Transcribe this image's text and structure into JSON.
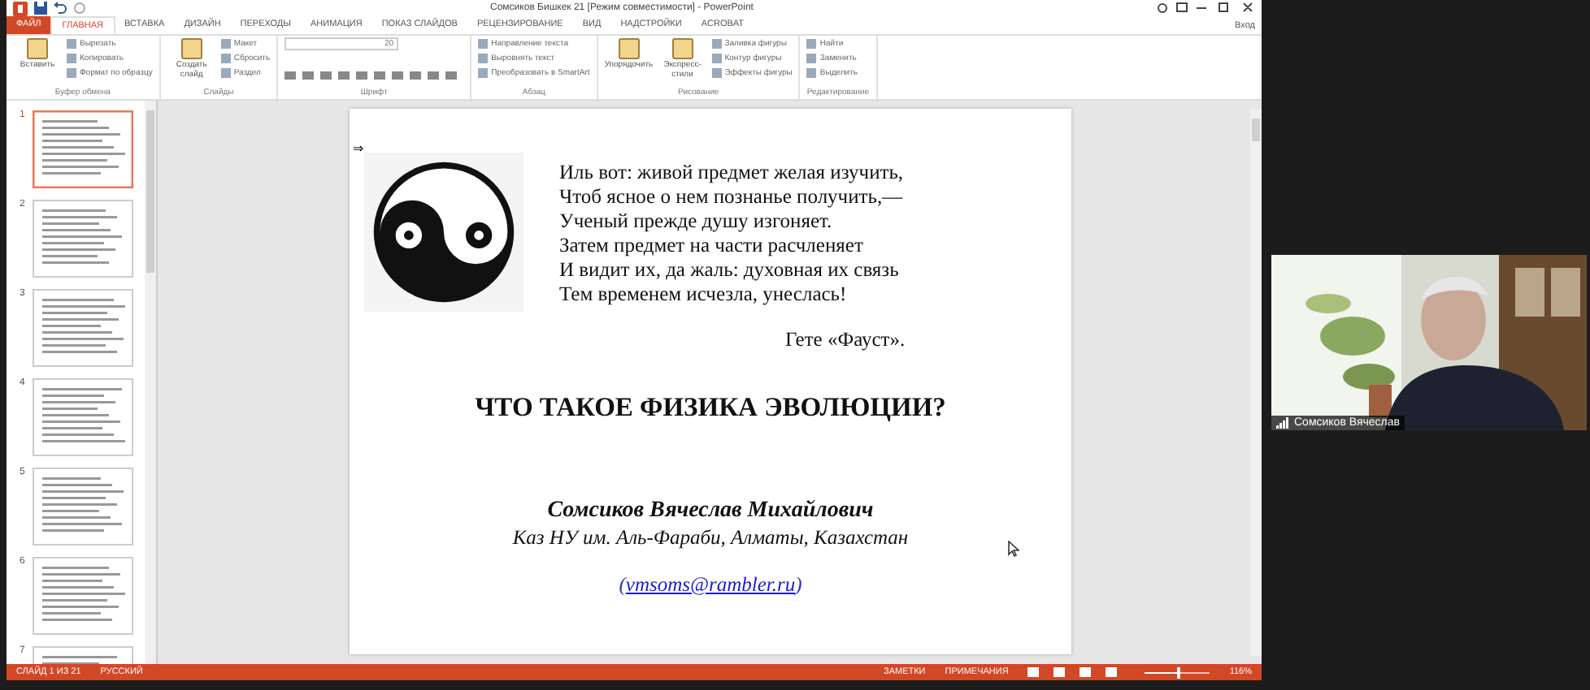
{
  "window": {
    "title": "Сомсиков Бишкек 21 [Режим совместимости] - PowerPoint",
    "sign_in": "Вход"
  },
  "ribbon_tabs": [
    {
      "label": "ФАЙЛ",
      "kind": "file",
      "selected": false
    },
    {
      "label": "ГЛАВНАЯ",
      "kind": "tab",
      "selected": true
    },
    {
      "label": "ВСТАВКА",
      "kind": "tab",
      "selected": false
    },
    {
      "label": "ДИЗАЙН",
      "kind": "tab",
      "selected": false
    },
    {
      "label": "ПЕРЕХОДЫ",
      "kind": "tab",
      "selected": false
    },
    {
      "label": "АНИМАЦИЯ",
      "kind": "tab",
      "selected": false
    },
    {
      "label": "ПОКАЗ СЛАЙДОВ",
      "kind": "tab",
      "selected": false
    },
    {
      "label": "РЕЦЕНЗИРОВАНИЕ",
      "kind": "tab",
      "selected": false
    },
    {
      "label": "ВИД",
      "kind": "tab",
      "selected": false
    },
    {
      "label": "НАДСТРОЙКИ",
      "kind": "tab",
      "selected": false
    },
    {
      "label": "ACROBAT",
      "kind": "tab",
      "selected": false
    }
  ],
  "ribbon_groups": [
    {
      "label": "Буфер обмена",
      "large": [
        "Вставить"
      ],
      "small": [
        "Вырезать",
        "Копировать",
        "Формат по образцу"
      ]
    },
    {
      "label": "Слайды",
      "large": [
        "Создать слайд"
      ],
      "small": [
        "Макет",
        "Сбросить",
        "Раздел"
      ]
    },
    {
      "label": "Шрифт",
      "font_size": "20"
    },
    {
      "label": "Абзац",
      "small": [
        "Направление текста",
        "Выровнять текст",
        "Преобразовать в SmartArt"
      ]
    },
    {
      "label": "Рисование",
      "large": [
        "Упорядочить",
        "Экспресс-стили"
      ],
      "small": [
        "Заливка фигуры",
        "Контур фигуры",
        "Эффекты фигуры"
      ]
    },
    {
      "label": "Редактирование",
      "small": [
        "Найти",
        "Заменить",
        "Выделить"
      ]
    }
  ],
  "thumbnails": [
    {
      "number": "1",
      "selected": true
    },
    {
      "number": "2",
      "selected": false
    },
    {
      "number": "3",
      "selected": false
    },
    {
      "number": "4",
      "selected": false
    },
    {
      "number": "5",
      "selected": false
    },
    {
      "number": "6",
      "selected": false
    },
    {
      "number": "7",
      "selected": false
    }
  ],
  "slide": {
    "marker": "⇒",
    "poem": [
      "Иль вот: живой предмет желая изучить,",
      "Чтоб ясное о нем познанье получить,—",
      "Ученый прежде душу изгоняет.",
      "Затем предмет на части расчленяет",
      "И видит их, да жаль: духовная их связь",
      "Тем временем исчезла, унеслась!"
    ],
    "attribution": "Гете «Фауст».",
    "title": "ЧТО ТАКОЕ ФИЗИКА ЭВОЛЮЦИИ?",
    "author": "Сомсиков Вячеслав Михайлович",
    "affiliation": "Каз НУ им. Аль-Фараби, Алматы, Казахстан",
    "email": {
      "before": "(",
      "link": "vmsoms@rambler.ru",
      "after": ")"
    }
  },
  "status_bar": {
    "slide_info": "СЛАЙД 1 ИЗ 21",
    "language": "РУССКИЙ",
    "notes": "ЗАМЕТКИ",
    "comments": "ПРИМЕЧАНИЯ",
    "zoom": "116%",
    "zoom_slider": {
      "level": 0.55
    }
  },
  "video": {
    "name": "Сомсиков Вячеслав"
  }
}
